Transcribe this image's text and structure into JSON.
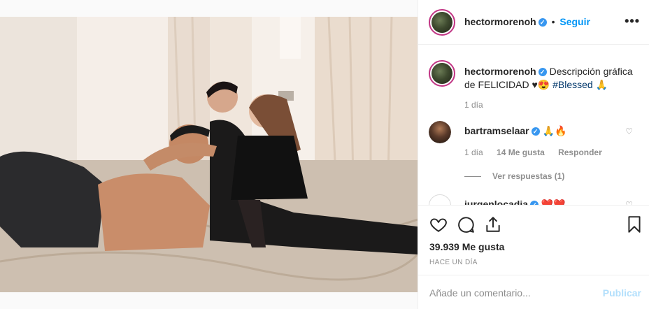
{
  "header": {
    "username": "hectormorenoh",
    "verified_badge": "✓",
    "separator": "•",
    "follow_label": "Seguir",
    "more_label": "•••"
  },
  "caption": {
    "username": "hectormorenoh",
    "text": "Descripción gráfica de FELICIDAD ♥😍",
    "hashtag": "#Blessed",
    "emoji_end": "🙏",
    "time": "1 día"
  },
  "comments": [
    {
      "username": "bartramselaar",
      "text": "🙏🔥",
      "time": "1 día",
      "likes": "14 Me gusta",
      "reply_label": "Responder",
      "view_replies": "Ver respuestas (1)"
    },
    {
      "username": "jurgenlocadia",
      "text": "❤️❤️"
    }
  ],
  "actions": {
    "likes": "39.939 Me gusta",
    "posted_ago": "HACE UN DÍA"
  },
  "composer": {
    "placeholder": "Añade un comentario...",
    "publish_label": "Publicar"
  },
  "colors": {
    "link": "#0095f6",
    "verified": "#3897f0",
    "publish_disabled": "#b2dffc",
    "secondary_text": "#8e8e8e"
  },
  "icons": [
    "heart-icon",
    "comment-icon",
    "share-icon",
    "bookmark-icon",
    "verified-icon",
    "more-icon"
  ]
}
